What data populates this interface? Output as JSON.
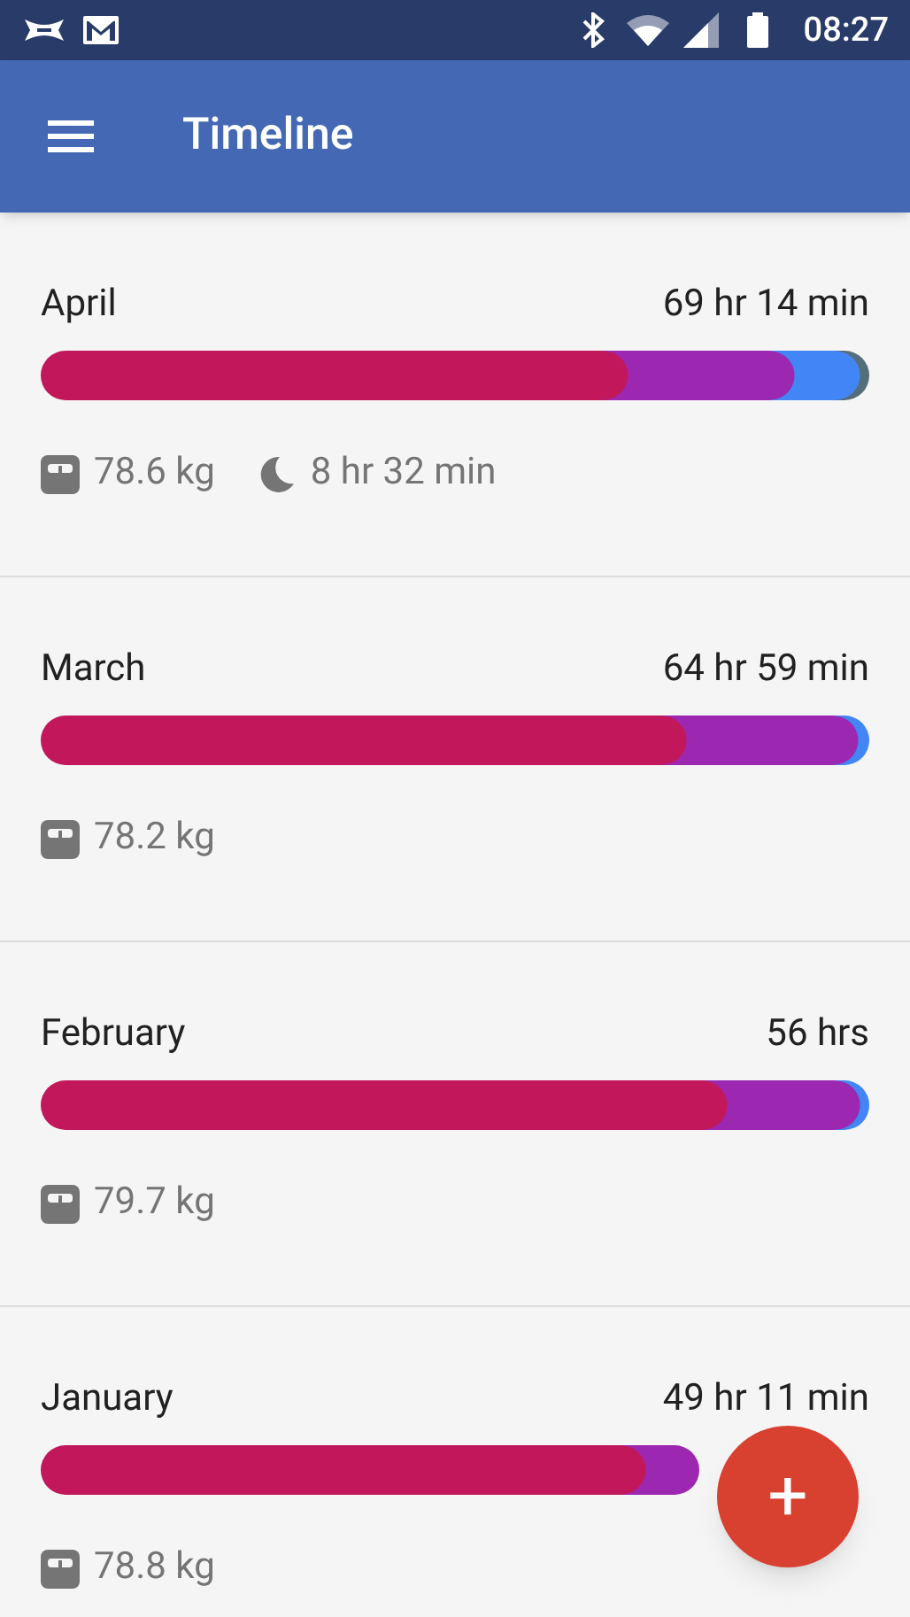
{
  "status_bar": {
    "time": "08:27"
  },
  "app_bar": {
    "title": "Timeline"
  },
  "months": [
    {
      "name": "April",
      "total": "69 hr 14 min",
      "segments": [
        {
          "color": "#c2185b"
        },
        {
          "color": "#9c27b0"
        },
        {
          "color": "#4285f4"
        },
        {
          "color": "#546e7a"
        }
      ],
      "weight": "78.6 kg",
      "sleep": "8 hr 32 min"
    },
    {
      "name": "March",
      "total": "64 hr 59 min",
      "segments": [
        {
          "color": "#c2185b"
        },
        {
          "color": "#9c27b0"
        },
        {
          "color": "#4285f4"
        }
      ],
      "weight": "78.2 kg"
    },
    {
      "name": "February",
      "total": "56 hrs",
      "segments": [
        {
          "color": "#c2185b"
        },
        {
          "color": "#9c27b0"
        },
        {
          "color": "#4285f4"
        }
      ],
      "weight": "79.7 kg"
    },
    {
      "name": "January",
      "total": "49 hr 11 min",
      "segments": [
        {
          "color": "#c2185b"
        },
        {
          "color": "#9c27b0"
        }
      ],
      "weight": "78.8 kg"
    }
  ],
  "fab": {
    "label": "+"
  }
}
